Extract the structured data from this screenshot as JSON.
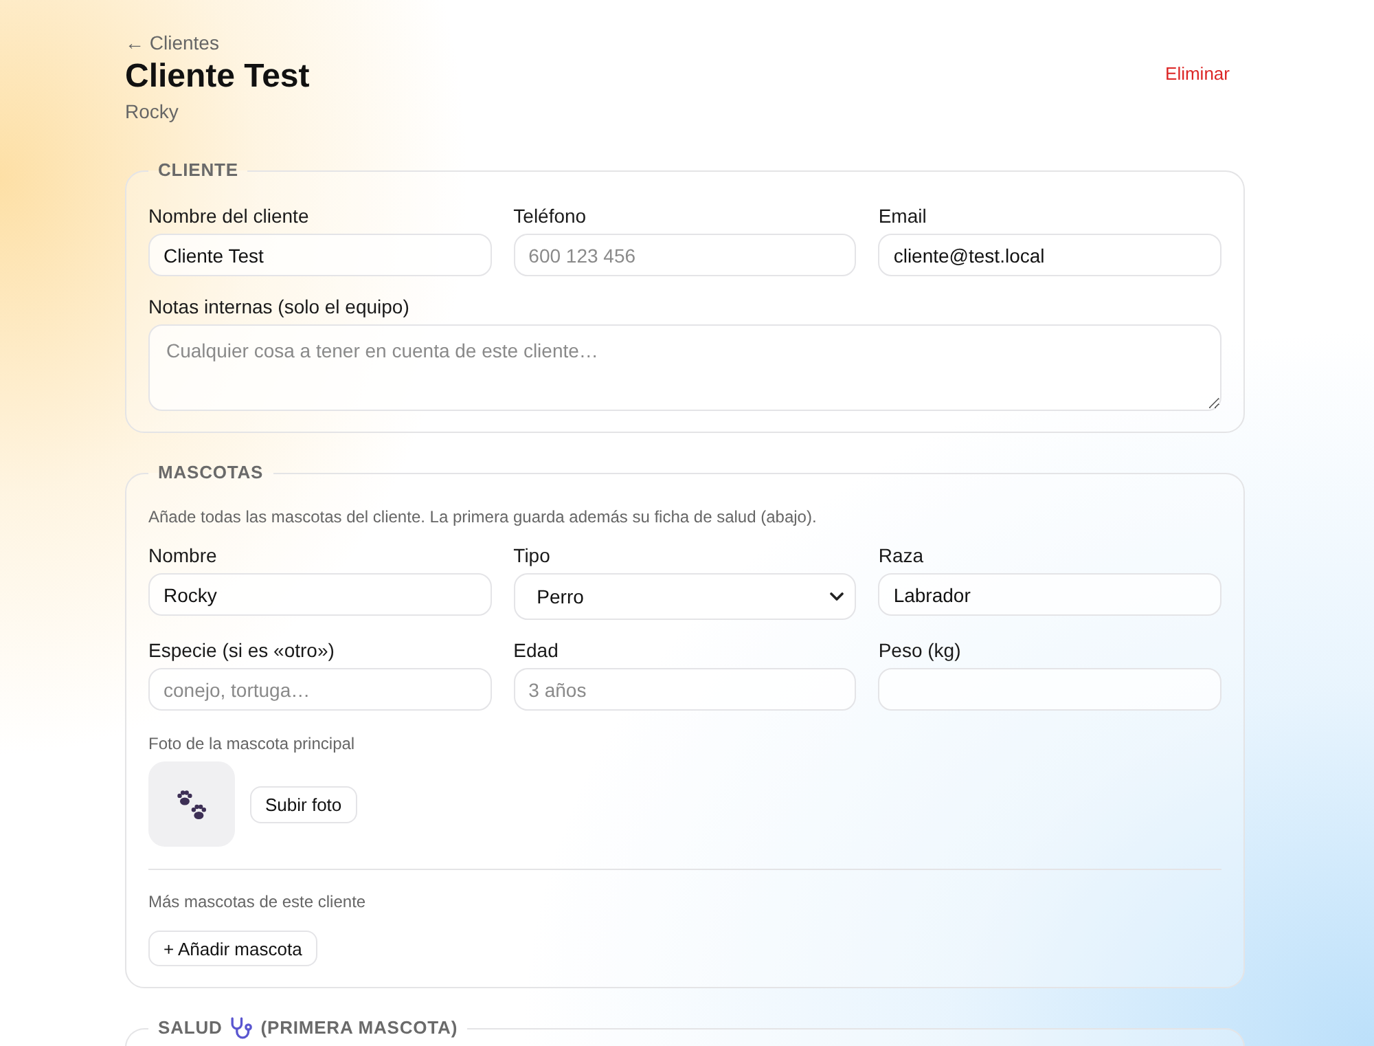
{
  "header": {
    "back_link": "← Clientes",
    "title": "Cliente Test",
    "subtitle": "Rocky",
    "delete_button": "Eliminar"
  },
  "sections": [
    {
      "kind": "client",
      "legend": "CLIENTE",
      "fields": [
        {
          "kind": "text",
          "label": "Nombre del cliente",
          "value": "Cliente Test"
        },
        {
          "kind": "text",
          "label": "Teléfono",
          "placeholder": "600 123 456"
        },
        {
          "kind": "text",
          "label": "Email",
          "value": "cliente@test.local"
        },
        {
          "kind": "textarea",
          "label": "Notas internas (solo el equipo)",
          "placeholder": "Cualquier cosa a tener en cuenta de este cliente…"
        }
      ]
    },
    {
      "kind": "pets",
      "legend": "MASCOTAS",
      "hint": "Añade todas las mascotas del cliente. La primera guarda además su ficha de salud (abajo).",
      "fields": [
        {
          "kind": "text",
          "label": "Nombre",
          "value": "Rocky"
        },
        {
          "kind": "select",
          "label": "Tipo",
          "value": "Perro"
        },
        {
          "kind": "text",
          "label": "Raza",
          "value": "Labrador"
        },
        {
          "kind": "text",
          "label": "Especie (si es «otro»)",
          "placeholder": "conejo, tortuga…"
        },
        {
          "kind": "text",
          "label": "Edad",
          "placeholder": "3 años"
        },
        {
          "kind": "text",
          "label": "Peso (kg)"
        }
      ],
      "photo": {
        "label": "Foto de la mascota principal",
        "button": "Subir foto"
      },
      "more_pets": {
        "label": "Más mascotas de este cliente",
        "button": "+ Añadir mascota"
      }
    },
    {
      "kind": "health",
      "legend": "SALUD",
      "legend_suffix": "(PRIMERA MASCOTA)"
    }
  ]
}
